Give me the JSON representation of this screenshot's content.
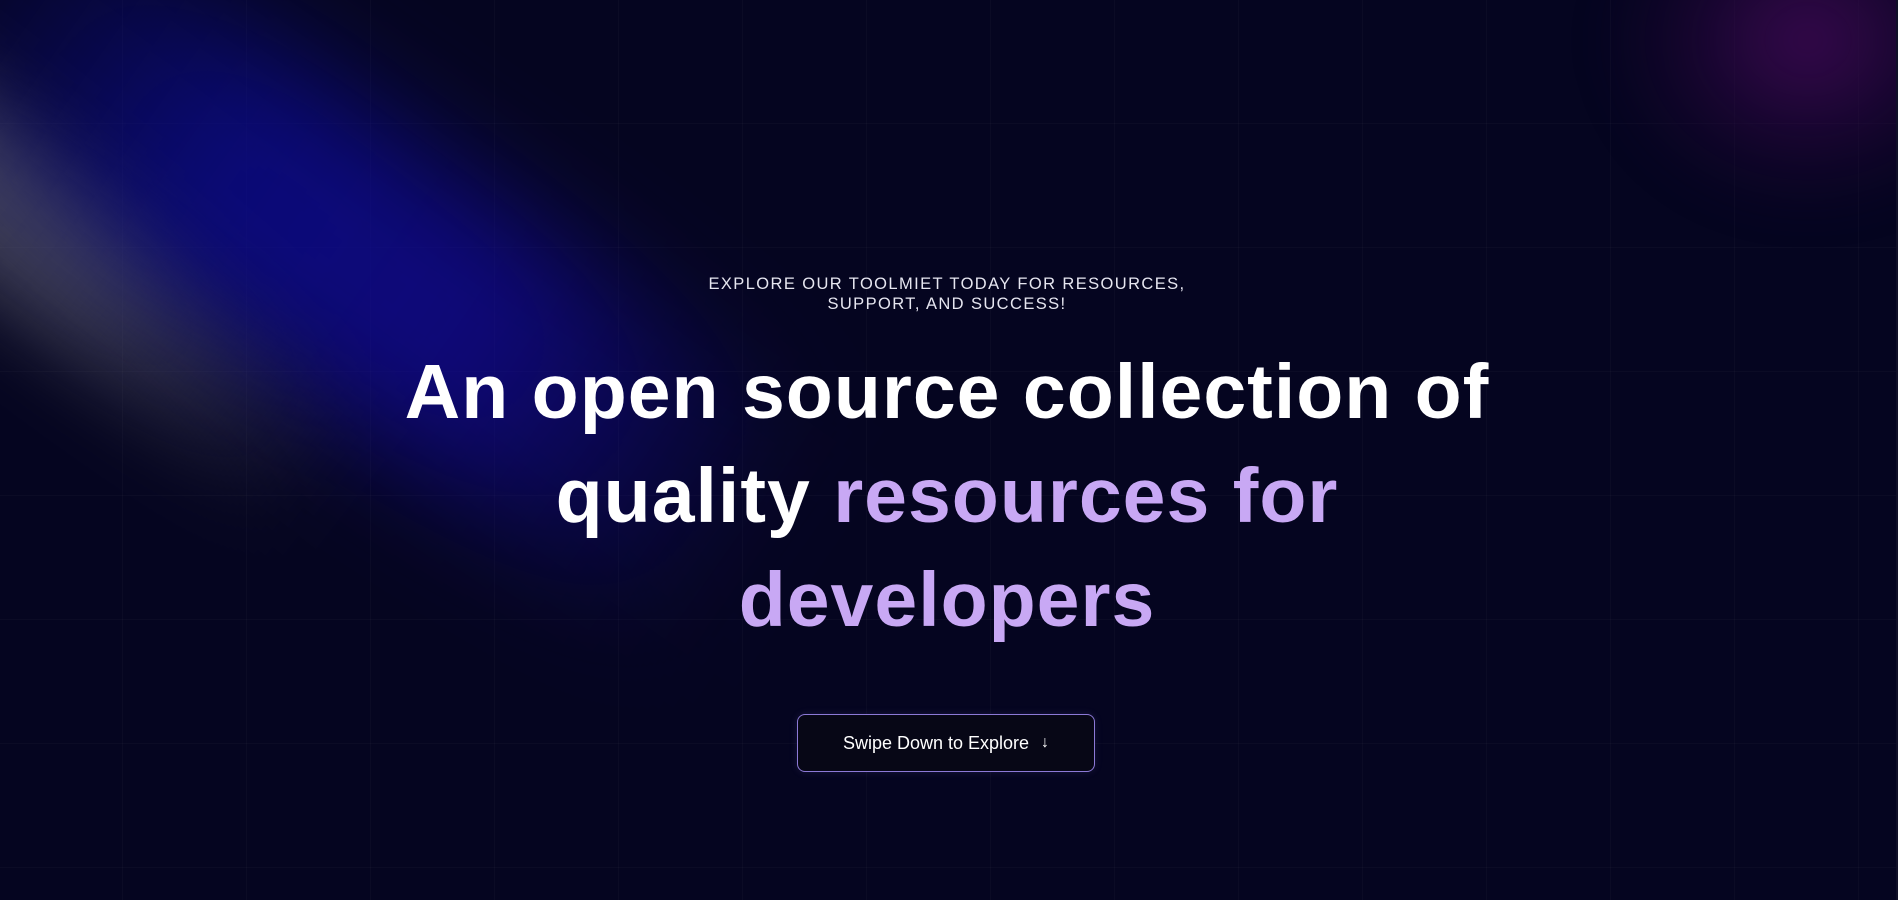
{
  "hero": {
    "eyebrow_line_1": "EXPLORE OUR TOOLMIET TODAY FOR RESOURCES,",
    "eyebrow_line_2": "SUPPORT, AND SUCCESS!",
    "headline_line_1": "An open source collection of",
    "headline_line_2_plain": "quality ",
    "headline_line_2_accent": "resources for",
    "headline_line_3_accent": "developers",
    "cta_label": "Swipe Down to Explore",
    "cta_icon": "arrow-down-icon",
    "cta_icon_glyph": "↓"
  },
  "colors": {
    "background": "#050520",
    "accent_text": "#c8a8f4",
    "cta_border": "#8c79d6",
    "glow_blue": "#0c0c96",
    "glow_purple": "#460a5a"
  }
}
